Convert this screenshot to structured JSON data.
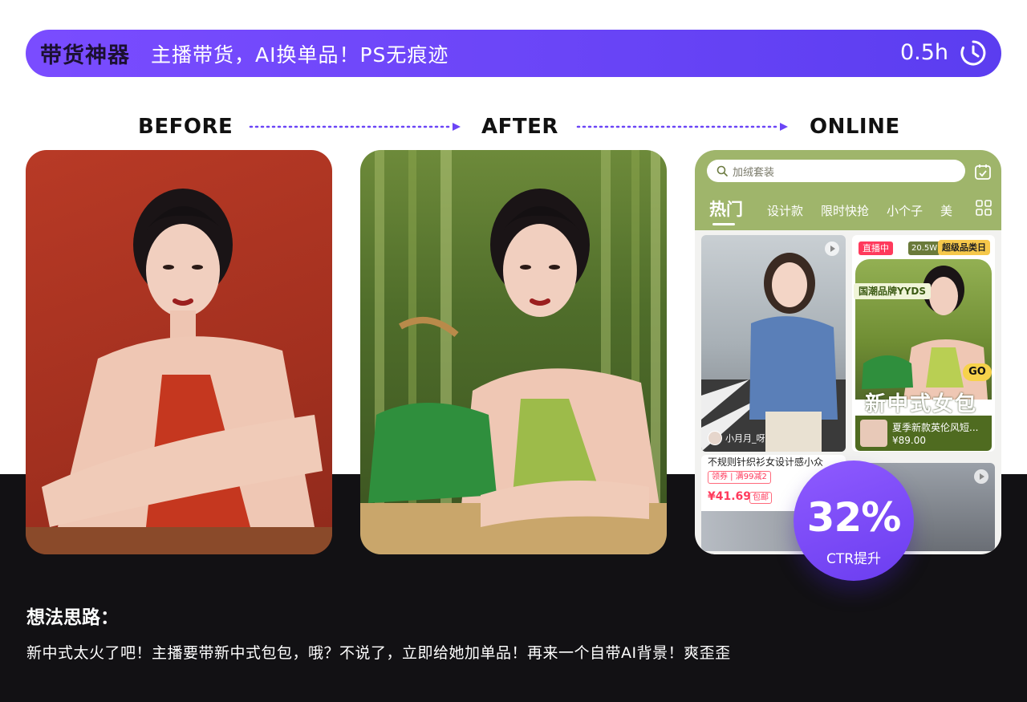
{
  "banner": {
    "tag": "带货神器",
    "title": "主播带货，AI换单品！PS无痕迹",
    "time": "0.5h",
    "clock_icon": "clock-icon"
  },
  "steps": {
    "before": "BEFORE",
    "after": "AFTER",
    "online": "ONLINE"
  },
  "online_app": {
    "search_placeholder": "加绒套装",
    "tabs": [
      "热门",
      "设计款",
      "限时快抢",
      "小个子",
      "美"
    ],
    "card_a": {
      "user": "小月月_呀"
    },
    "card_b": {
      "live": "直播中",
      "views": "20.5W",
      "brand": "超级品类日",
      "guochao": "国潮品牌YYDS",
      "go": "GO",
      "big_title": "新中式女包",
      "product_name": "夏季新款英伦风短...",
      "product_price": "¥89.00"
    },
    "card_c": {
      "title": "不规则针织衫女设计感小众",
      "coupon": "领券 | 满99减2",
      "price": "¥41.69",
      "tag": "包邮"
    }
  },
  "ctr": {
    "value": "32%",
    "label": "CTR提升"
  },
  "idea": {
    "heading": "想法思路：",
    "body": "新中式太火了吧！主播要带新中式包包，哦？不说了，立即给她加单品！再来一个自带AI背景！爽歪歪"
  },
  "colors": {
    "accent": "#6b45f6",
    "bottom_bg": "#121114",
    "app_green": "#9fb56b"
  }
}
